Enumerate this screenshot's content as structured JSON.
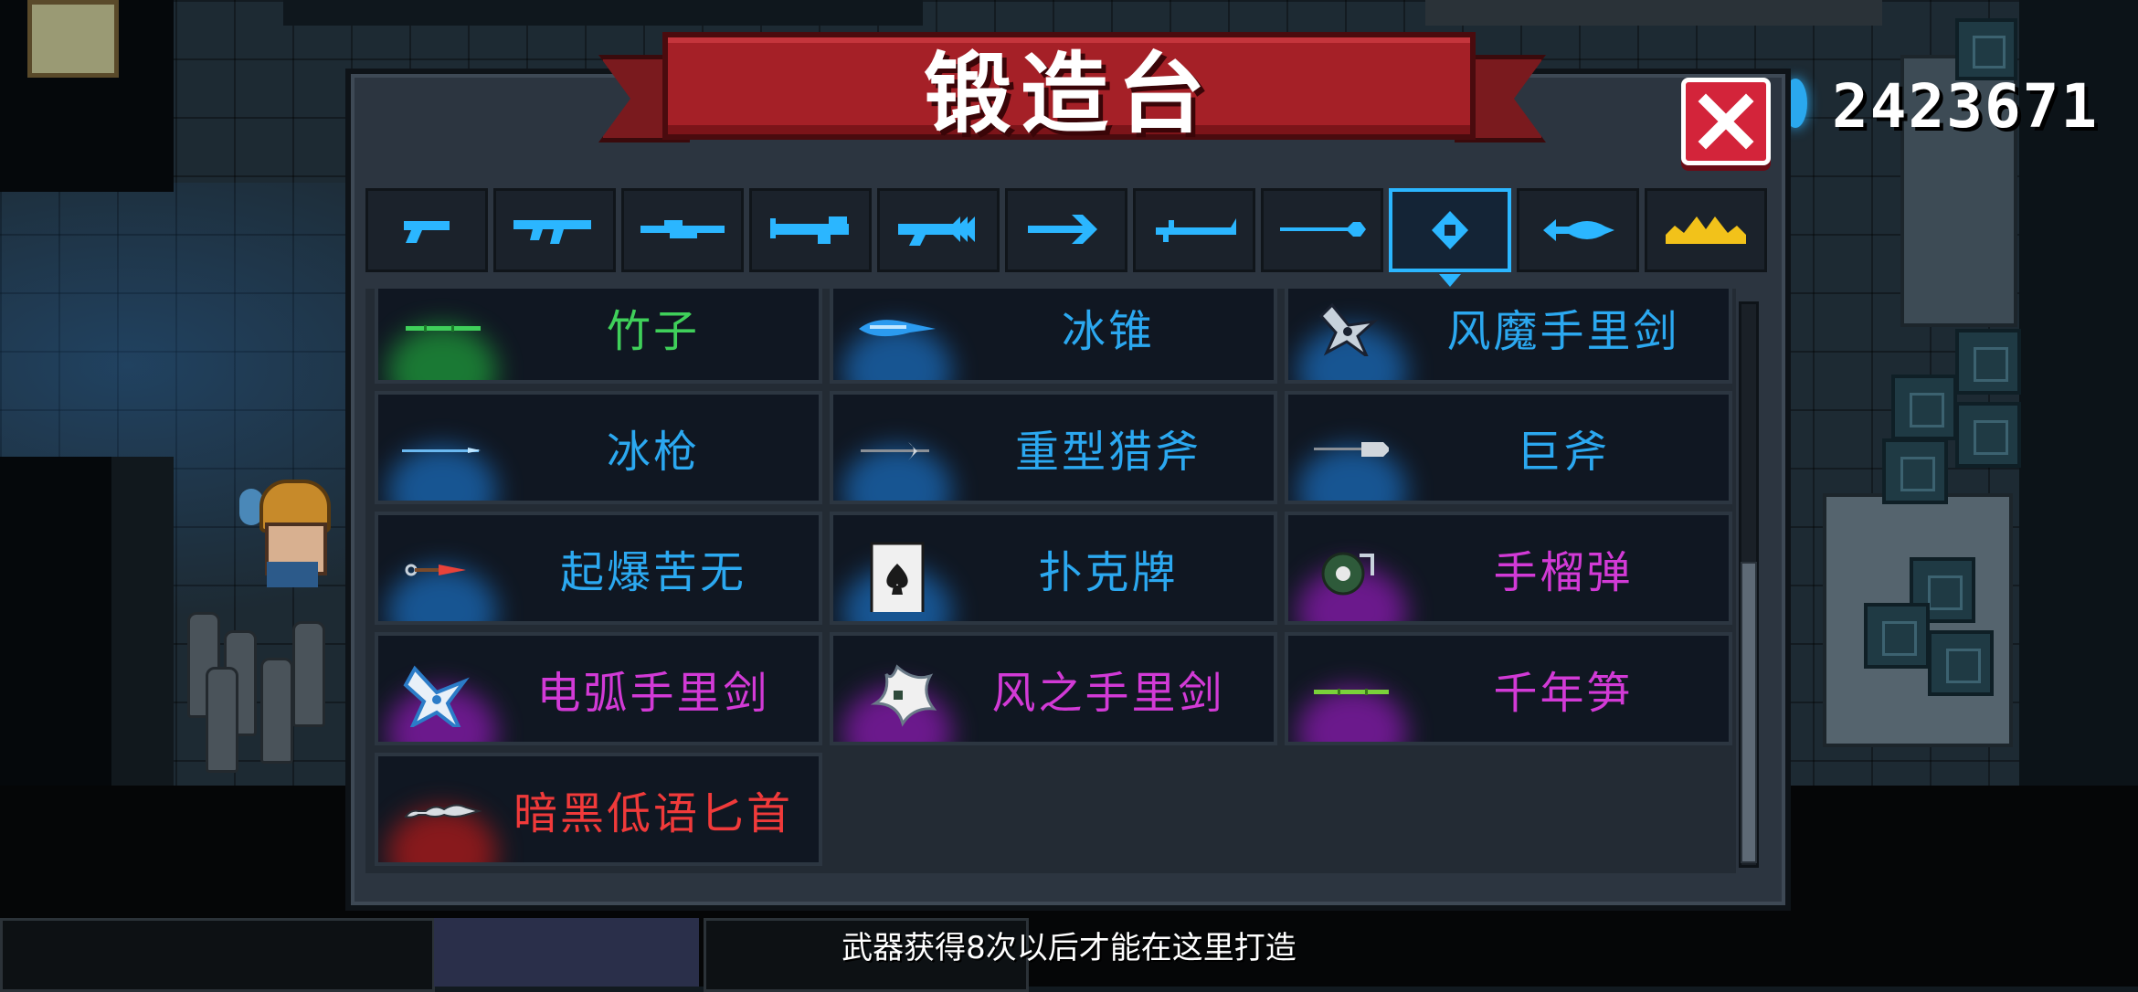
{
  "currency": {
    "icon": "blue-gem-icon",
    "amount": "2423671"
  },
  "forge": {
    "title": "锻造台",
    "close_icon": "close-icon",
    "tabs": [
      {
        "icon": "pistol-icon",
        "active": false
      },
      {
        "icon": "assault-rifle-icon",
        "active": false
      },
      {
        "icon": "sniper-rifle-icon",
        "active": false
      },
      {
        "icon": "heavy-gun-icon",
        "active": false
      },
      {
        "icon": "spiked-launcher-icon",
        "active": false
      },
      {
        "icon": "crossbow-icon",
        "active": false
      },
      {
        "icon": "sword-icon",
        "active": false
      },
      {
        "icon": "spear-icon",
        "active": false
      },
      {
        "icon": "throwable-icon",
        "active": true
      },
      {
        "icon": "fish-icon",
        "active": false
      },
      {
        "icon": "crown-icon",
        "active": false
      }
    ],
    "items": [
      {
        "name": "竹子",
        "rarity": "green",
        "icon": "bamboo-icon"
      },
      {
        "name": "冰锥",
        "rarity": "blue",
        "icon": "ice-cone-icon"
      },
      {
        "name": "风魔手里剑",
        "rarity": "blue",
        "icon": "shuriken-icon"
      },
      {
        "name": "冰枪",
        "rarity": "blue",
        "icon": "ice-spear-icon"
      },
      {
        "name": "重型猎斧",
        "rarity": "blue",
        "icon": "heavy-axe-icon"
      },
      {
        "name": "巨斧",
        "rarity": "blue",
        "icon": "giant-axe-icon"
      },
      {
        "name": "起爆苦无",
        "rarity": "blue",
        "icon": "kunai-icon"
      },
      {
        "name": "扑克牌",
        "rarity": "blue",
        "icon": "playing-card-icon"
      },
      {
        "name": "手榴弹",
        "rarity": "purple",
        "icon": "grenade-icon"
      },
      {
        "name": "电弧手里剑",
        "rarity": "purple",
        "icon": "arc-shuriken-icon"
      },
      {
        "name": "风之手里剑",
        "rarity": "purple",
        "icon": "wind-shuriken-icon"
      },
      {
        "name": "千年笋",
        "rarity": "purple",
        "icon": "bamboo-shoot-icon"
      },
      {
        "name": "暗黑低语匕首",
        "rarity": "red",
        "icon": "dagger-icon"
      }
    ],
    "hint": "武器获得8次以后才能在这里打造"
  },
  "colors": {
    "banner": "#a52027",
    "tab_active": "#2bb6ff",
    "rarity_green": "#3fd05a",
    "rarity_blue": "#2ba8f0",
    "rarity_purple": "#d23ad6",
    "rarity_red": "#f03a3a"
  }
}
